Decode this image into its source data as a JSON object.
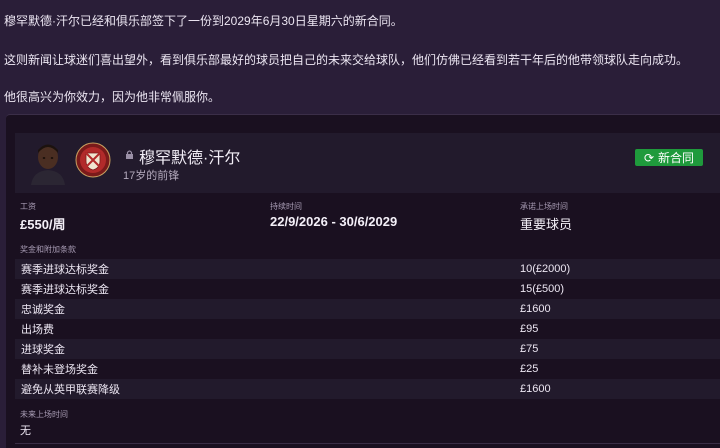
{
  "news": {
    "line1": "穆罕默德·汗尔已经和俱乐部签下了一份到2029年6月30日星期六的新合同。",
    "line2": "这则新闻让球迷们喜出望外，看到俱乐部最好的球员把自己的未来交给球队，他们仿佛已经看到若干年后的他带领球队走向成功。",
    "line3": "他很高兴为你效力，因为他非常佩服你。"
  },
  "player": {
    "name": "穆罕默德·汗尔",
    "subtitle": "17岁的前锋",
    "new_contract_label": "新合同"
  },
  "contract": {
    "wage_label": "工资",
    "wage_value": "£550/周",
    "duration_label": "持续时间",
    "duration_value": "22/9/2026 - 30/6/2029",
    "playing_time_label": "承诺上场时间",
    "playing_time_value": "重要球员",
    "bonus_header": "奖金和附加条款",
    "bonuses": [
      {
        "name": "赛季进球达标奖金",
        "value": "10(£2000)"
      },
      {
        "name": "赛季进球达标奖金",
        "value": "15(£500)"
      },
      {
        "name": "忠诚奖金",
        "value": "£1600"
      },
      {
        "name": "出场费",
        "value": "£95"
      },
      {
        "name": "进球奖金",
        "value": "£75"
      },
      {
        "name": "替补未登场奖金",
        "value": "£25"
      },
      {
        "name": "避免从英甲联赛降级",
        "value": "£1600"
      }
    ],
    "future_label": "未来上场时间",
    "future_value": "无"
  },
  "colors": {
    "background": "#2a1e38",
    "card": "#1a1020",
    "row_alt": "#221a2c",
    "accent_green": "#1f9a3c"
  }
}
